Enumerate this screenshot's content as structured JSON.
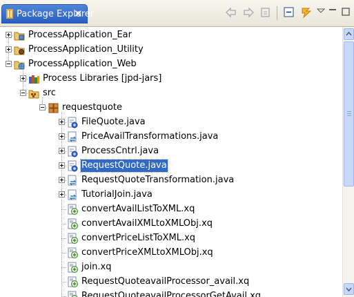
{
  "tab": {
    "title": "Package Explorer",
    "close": "✕"
  },
  "toolbar": [
    "back-icon",
    "forward-icon",
    "home-icon",
    "collapse-all-icon",
    "link-with-editor-icon",
    "view-menu-icon",
    "minimize-icon",
    "maximize-icon"
  ],
  "tree": [
    {
      "label": "ProcessApplication_Ear",
      "icon": "ear-project-icon",
      "expander": "plus",
      "level": 0
    },
    {
      "label": "ProcessApplication_Utility",
      "icon": "utility-project-icon",
      "expander": "plus",
      "level": 0
    },
    {
      "label": "ProcessApplication_Web",
      "icon": "web-project-icon",
      "expander": "minus",
      "level": 0
    },
    {
      "label": "Process Libraries [jpd-jars]",
      "icon": "library-icon",
      "expander": "plus",
      "level": 1
    },
    {
      "label": "src",
      "icon": "source-folder-icon",
      "expander": "minus",
      "level": 1
    },
    {
      "label": "requestquote",
      "icon": "package-icon",
      "expander": "minus",
      "level": 2
    },
    {
      "label": "FileQuote.java",
      "icon": "java-process-icon",
      "expander": "plus",
      "level": 3
    },
    {
      "label": "PriceAvailTransformations.java",
      "icon": "transformation-icon",
      "expander": "plus",
      "level": 3
    },
    {
      "label": "ProcessCntrl.java",
      "icon": "java-process-icon",
      "expander": "plus",
      "level": 3
    },
    {
      "label": "RequestQuote.java",
      "icon": "java-process-icon",
      "expander": "plus",
      "level": 3,
      "selected": true
    },
    {
      "label": "RequestQuoteTransformation.java",
      "icon": "transformation-icon",
      "expander": "plus",
      "level": 3
    },
    {
      "label": "TutorialJoin.java",
      "icon": "transformation-icon",
      "expander": "plus",
      "level": 3
    },
    {
      "label": "convertAvailListToXML.xq",
      "icon": "xquery-icon",
      "expander": null,
      "level": 3
    },
    {
      "label": "convertAvailXMLtoXMLObj.xq",
      "icon": "xquery-icon",
      "expander": null,
      "level": 3
    },
    {
      "label": "convertPriceListToXML.xq",
      "icon": "xquery-icon",
      "expander": null,
      "level": 3
    },
    {
      "label": "convertPriceXMLtoXMLObj.xq",
      "icon": "xquery-icon",
      "expander": null,
      "level": 3
    },
    {
      "label": "join.xq",
      "icon": "xquery-icon",
      "expander": null,
      "level": 3
    },
    {
      "label": "RequestQuoteavailProcessor_avail.xq",
      "icon": "xquery-icon",
      "expander": null,
      "level": 3
    },
    {
      "label": "RequestQuoteavailProcessorGetAvail.xq",
      "icon": "xquery-icon",
      "expander": null,
      "level": 3
    }
  ],
  "colors": {
    "tab_active": "#2a5ec2",
    "selection": "#316ac5",
    "guide": "#a0a0a0"
  }
}
